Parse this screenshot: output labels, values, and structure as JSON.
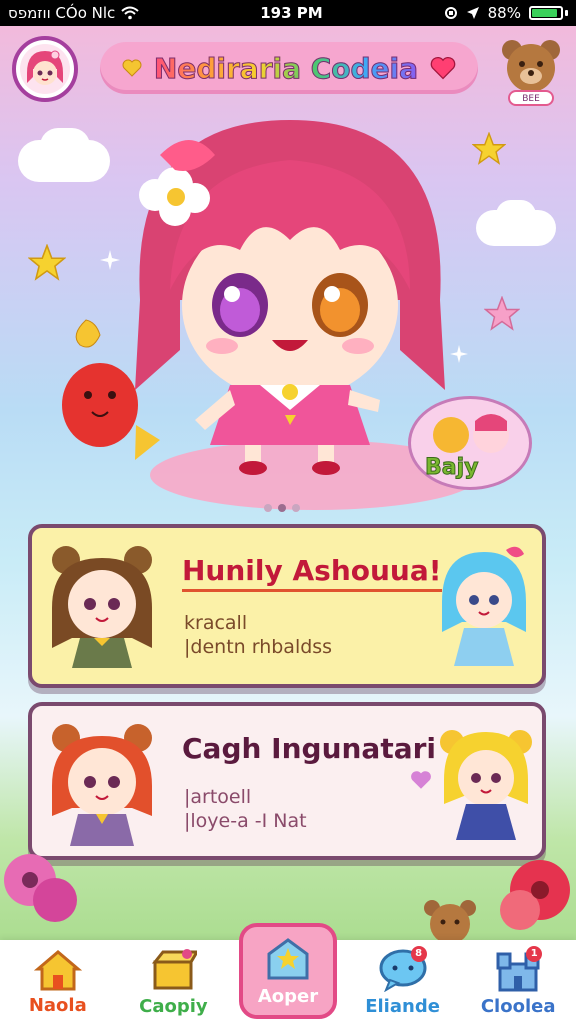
{
  "status_bar": {
    "carrier": "ווזמפס CÓo Nlc",
    "time": "193 PM",
    "battery_percent": "88%",
    "battery_level": 0.88
  },
  "header": {
    "title": "Nediraria Codeia",
    "bear_label": "BEE"
  },
  "hero": {
    "bubble_badge_text": "Bajy",
    "carousel_dots": 3,
    "active_dot": 1
  },
  "cards": [
    {
      "title": "Hunily Ashouua!",
      "line1": "kracall",
      "line2": "|dentn rhbaldss"
    },
    {
      "title": "Cagh Ingunatari",
      "line1": "|artoell",
      "line2": "|loуе-a -I Nat"
    }
  ],
  "bottom_nav": {
    "items": [
      {
        "label": "Naola",
        "icon": "house-icon",
        "color": "#e8501f"
      },
      {
        "label": "Caopiy",
        "icon": "treasure-box-icon",
        "color": "#3fae4a"
      },
      {
        "label": "Aoper",
        "icon": "star-house-icon",
        "color": "#ffffff",
        "active": true
      },
      {
        "label": "Eliande",
        "icon": "chat-bubble-icon",
        "color": "#2f8fd6",
        "badge": "8"
      },
      {
        "label": "Cloolea",
        "icon": "castle-icon",
        "color": "#3a73c9",
        "badge": "1"
      }
    ]
  },
  "colors": {
    "accent_pink": "#e24a86",
    "card1_bg": "#fbf1a8",
    "card2_bg": "#fbeff0",
    "card_border": "#7a4a6e"
  }
}
